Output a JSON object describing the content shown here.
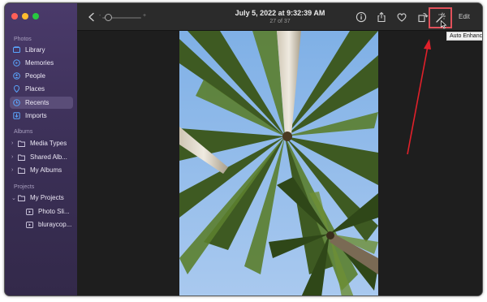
{
  "window": {
    "title": "July 5, 2022 at 9:32:39 AM",
    "subtitle": "27 of 37"
  },
  "sidebar": {
    "sections": [
      {
        "label": "Photos"
      },
      {
        "label": "Albums"
      },
      {
        "label": "Projects"
      }
    ],
    "photos_items": [
      {
        "label": "Library",
        "icon": "library-icon"
      },
      {
        "label": "Memories",
        "icon": "memories-icon"
      },
      {
        "label": "People",
        "icon": "people-icon"
      },
      {
        "label": "Places",
        "icon": "places-icon"
      },
      {
        "label": "Recents",
        "icon": "recents-icon",
        "selected": true
      },
      {
        "label": "Imports",
        "icon": "imports-icon"
      }
    ],
    "albums_items": [
      {
        "label": "Media Types",
        "icon": "folder-icon"
      },
      {
        "label": "Shared Albums",
        "display": "Shared Alb...",
        "icon": "folder-icon"
      },
      {
        "label": "My Albums",
        "icon": "folder-icon"
      }
    ],
    "projects_items": [
      {
        "label": "My Projects",
        "icon": "folder-icon"
      },
      {
        "label": "Photo Sli...",
        "icon": "slideshow-icon"
      },
      {
        "label": "bluraycop...",
        "icon": "slideshow-icon"
      }
    ]
  },
  "toolbar": {
    "back_icon": "chevron-left-icon",
    "zoom_min_label": "-",
    "zoom_max_label": "+",
    "info_icon": "info-icon",
    "share_icon": "share-icon",
    "favorite_icon": "heart-icon",
    "rotate_icon": "rotate-icon",
    "enhance_icon": "magic-wand-icon",
    "edit_label": "Edit",
    "tooltip": "Auto Enhance"
  },
  "annotation": {
    "arrow_color": "#e0202a",
    "highlight_color": "#e0505a"
  },
  "colors": {
    "sidebar_top": "#4a3a6a",
    "sidebar_selected": "#5a4d78",
    "sidebar_icon": "#5aa6ff",
    "main_bg": "#1e1e1e"
  }
}
